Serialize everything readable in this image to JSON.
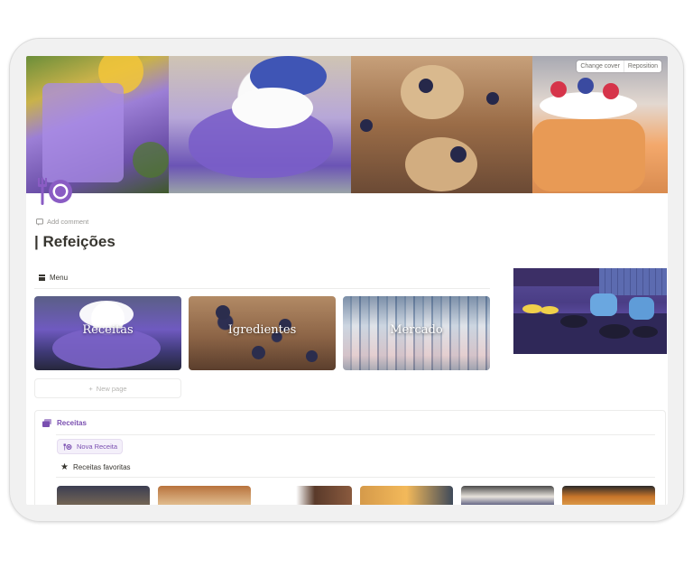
{
  "cover": {
    "change_cover": "Change cover",
    "reposition": "Reposition"
  },
  "page": {
    "add_comment": "Add comment",
    "title": "| Refeições"
  },
  "menu": {
    "label": "Menu",
    "cards": [
      {
        "label": "Receitas"
      },
      {
        "label": "Igredientes"
      },
      {
        "label": "Mercado"
      }
    ],
    "new_page": "New page"
  },
  "receitas": {
    "title": "Receitas",
    "new_button": "Nova Receita",
    "favorites_label": "Receitas favoritas"
  },
  "colors": {
    "accent": "#7a4fb0",
    "text": "#37352f",
    "muted": "#9b9a97"
  }
}
